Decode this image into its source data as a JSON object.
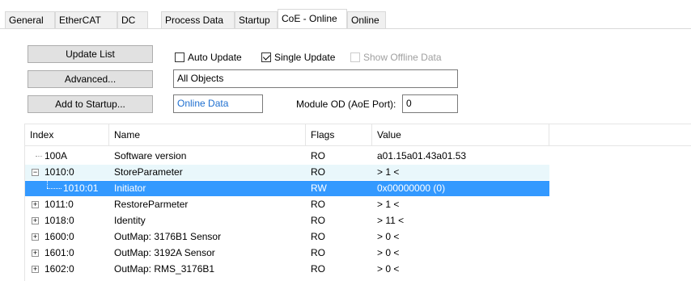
{
  "tabs": [
    {
      "label": "General"
    },
    {
      "label": "EtherCAT"
    },
    {
      "label": "DC"
    },
    {
      "label": "Process Data"
    },
    {
      "label": "Startup"
    },
    {
      "label": "CoE - Online"
    },
    {
      "label": "Online"
    }
  ],
  "active_tab": "CoE - Online",
  "buttons": {
    "update_list": "Update List",
    "advanced": "Advanced...",
    "add_to_startup": "Add to Startup..."
  },
  "checkboxes": {
    "auto_update": {
      "label": "Auto Update",
      "checked": false
    },
    "single_update": {
      "label": "Single Update",
      "checked": true
    },
    "show_offline": {
      "label": "Show Offline Data",
      "checked": false,
      "disabled": true
    }
  },
  "filter_field": {
    "value": "All Objects"
  },
  "data_source_field": {
    "value": "Online Data"
  },
  "module_od": {
    "label": "Module OD (AoE Port):",
    "value": "0"
  },
  "columns": {
    "index": "Index",
    "name": "Name",
    "flags": "Flags",
    "value": "Value"
  },
  "rows": [
    {
      "index": "100A",
      "name": "Software version",
      "flags": "RO",
      "value": "a01.15a01.43a01.53",
      "expander": ""
    },
    {
      "index": "1010:0",
      "name": "StoreParameter",
      "flags": "RO",
      "value": "> 1 <",
      "expander": "−"
    },
    {
      "index": "1010:01",
      "name": "Initiator",
      "flags": "RW",
      "value": "0x00000000 (0)",
      "expander": "",
      "selected": true
    },
    {
      "index": "1011:0",
      "name": "RestoreParmeter",
      "flags": "RO",
      "value": "> 1 <",
      "expander": "+"
    },
    {
      "index": "1018:0",
      "name": "Identity",
      "flags": "RO",
      "value": "> 11 <",
      "expander": "+"
    },
    {
      "index": "1600:0",
      "name": "OutMap: 3176B1 Sensor",
      "flags": "RO",
      "value": "> 0 <",
      "expander": "+"
    },
    {
      "index": "1601:0",
      "name": "OutMap: 3192A Sensor",
      "flags": "RO",
      "value": "> 0 <",
      "expander": "+"
    },
    {
      "index": "1602:0",
      "name": "OutMap: RMS_3176B1",
      "flags": "RO",
      "value": "> 0 <",
      "expander": "+"
    }
  ],
  "colors": {
    "selection": "#3399ff",
    "alt_row": "#e9f7fb",
    "link_text": "#1e6fd0"
  }
}
